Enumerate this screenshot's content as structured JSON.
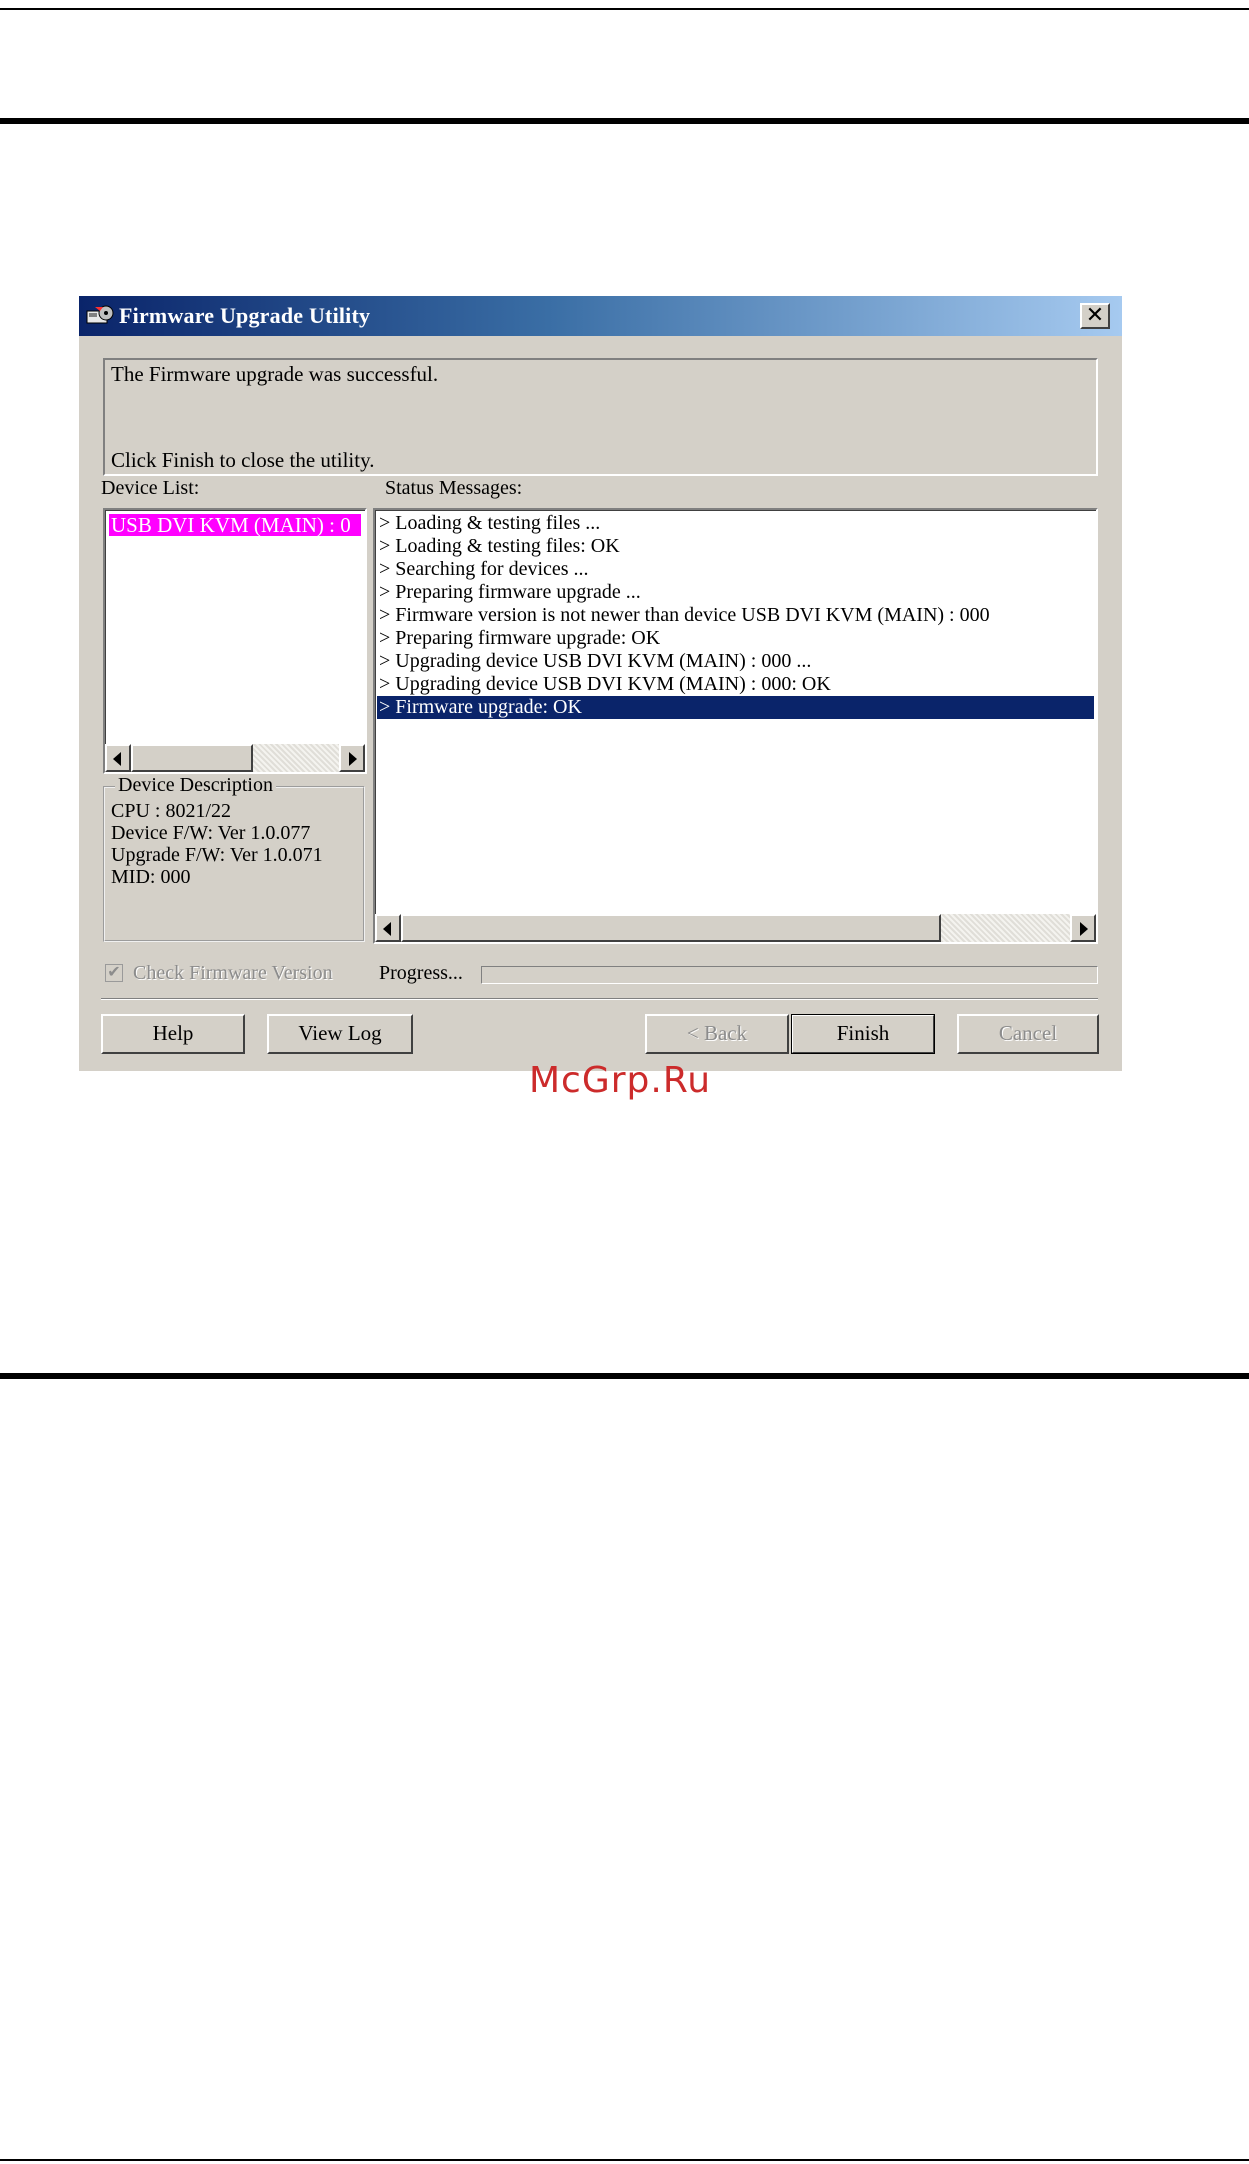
{
  "dialog": {
    "title": "Firmware Upgrade Utility",
    "close_glyph": "✕",
    "message_line1": "The Firmware upgrade was successful.",
    "message_line2": "Click Finish to close the utility.",
    "device_list_label": "Device List:",
    "status_label": "Status Messages:",
    "device_list_items": [
      "USB DVI KVM (MAIN) : 0"
    ],
    "device_item_color": "#ff00ff",
    "device_description": {
      "title": "Device Description",
      "lines": [
        "CPU : 8021/22",
        "Device F/W: Ver 1.0.077",
        "Upgrade F/W: Ver 1.0.071",
        "MID: 000"
      ]
    },
    "status_messages": [
      "> Loading & testing files ...",
      "> Loading & testing files: OK",
      "> Searching for devices ...",
      "> Preparing firmware upgrade ...",
      "> Firmware version is not newer than device USB DVI KVM (MAIN) : 000",
      "> Preparing firmware upgrade: OK",
      "> Upgrading device USB DVI KVM (MAIN) : 000 ...",
      "> Upgrading device USB DVI KVM (MAIN) : 000: OK",
      "> Firmware upgrade: OK"
    ],
    "selected_status_index": 8,
    "selection_color": "#0a246a",
    "check_firmware_label": "Check Firmware Version",
    "check_firmware_checked": true,
    "check_firmware_enabled": false,
    "progress_label": "Progress...",
    "progress_fraction": 0.0,
    "buttons": {
      "help": "Help",
      "view_log": "View Log",
      "back": "< Back",
      "finish": "Finish",
      "cancel": "Cancel"
    }
  },
  "watermark": "McGrp.Ru"
}
